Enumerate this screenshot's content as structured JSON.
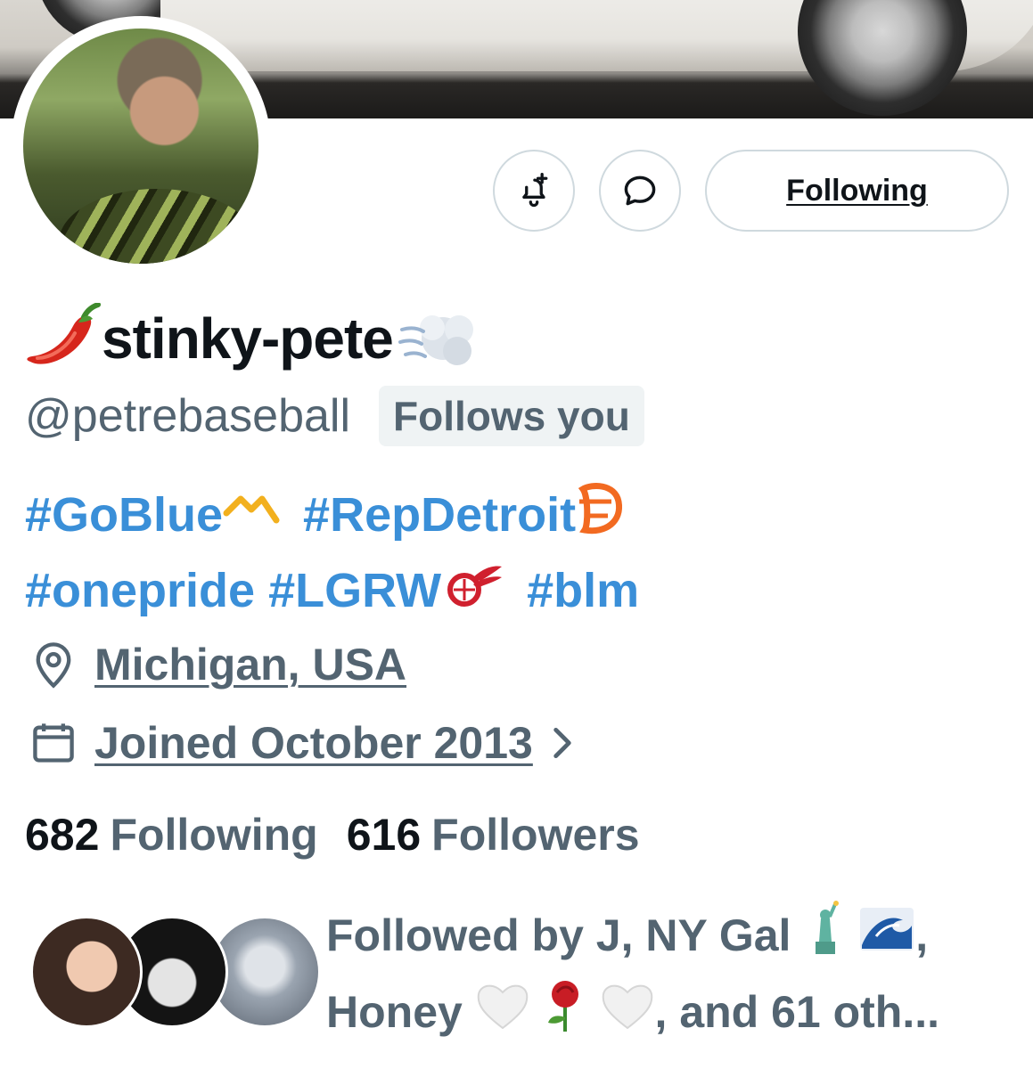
{
  "profile": {
    "display_name": "stinky-pete",
    "handle": "@petrebaseball",
    "follows_you_badge": "Follows you",
    "bio": {
      "tag1": "#GoBlue",
      "tag2": "#RepDetroit",
      "tag3": "#onepride",
      "tag4": "#LGRW",
      "tag5": "#blm"
    },
    "location": "Michigan, USA",
    "joined": "Joined October 2013"
  },
  "actions": {
    "following_label": "Following",
    "notify_icon": "bell-plus-icon",
    "message_icon": "message-bubble-icon"
  },
  "stats": {
    "following_count": "682",
    "following_label": "Following",
    "followers_count": "616",
    "followers_label": "Followers"
  },
  "followed_by": {
    "line1": "Followed by J, NY Gal",
    "line1_end": ",",
    "line2_start": "Honey",
    "line2_end": ", and 61 oth..."
  },
  "colors": {
    "link": "#3a8fd8",
    "secondary_text": "#536471",
    "primary_text": "#0f1419",
    "border": "#cfd9de"
  }
}
